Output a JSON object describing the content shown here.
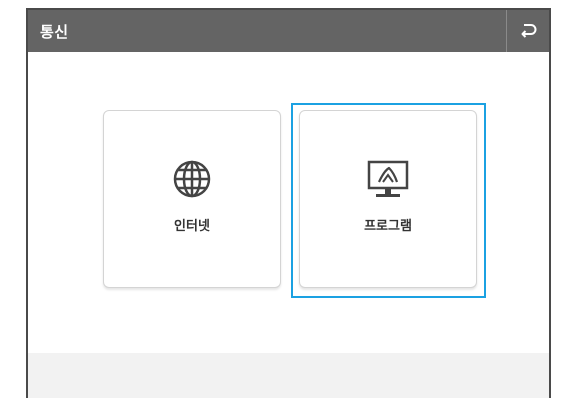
{
  "header": {
    "title": "통신",
    "back_icon": "return-arrow-icon"
  },
  "tiles": [
    {
      "label": "인터넷",
      "icon": "globe-icon"
    },
    {
      "label": "프로그램",
      "icon": "monitor-icon"
    }
  ],
  "colors": {
    "titlebar": "#646464",
    "focus": "#1ba1e2",
    "footer": "#f2f2f2"
  },
  "selected_tile": "프로그램"
}
